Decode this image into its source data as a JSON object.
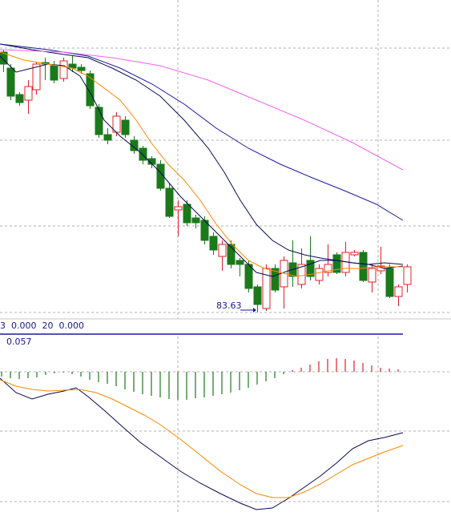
{
  "price_panel": {
    "low_marker_label": "83.63",
    "colors": {
      "up_candle": "#e0202a",
      "down_candle": "#1a7a1a",
      "ma_short": "#0a0a50",
      "ma_mid": "#ff8800",
      "ma_long": "#1a1aa0",
      "ma_longest": "#ee66ee",
      "grid": "#b0b0b0"
    }
  },
  "volume_header": {
    "text": "3  0.000  20  0.000"
  },
  "macd_header": {
    "text": "0.057"
  },
  "chart_data": [
    {
      "type": "candlestick",
      "title": "",
      "annotations": [
        "83.63"
      ],
      "moving_averages": [
        {
          "name": "",
          "color": "#0a0a50"
        },
        {
          "name": "",
          "color": "#ff8800"
        },
        {
          "name": "",
          "color": "#1a1aa0"
        },
        {
          "name": "",
          "color": "#ee66ee"
        }
      ]
    },
    {
      "type": "bar",
      "title": "",
      "values": [
        -0.6,
        -0.8,
        -0.9,
        -0.8,
        -0.7,
        -0.4,
        -0.2,
        -0.1,
        -0.3,
        -0.6,
        -1.0,
        -1.3,
        -1.5,
        -1.8,
        -2.2,
        -2.5,
        -2.8,
        -3.0,
        -3.2,
        -3.4,
        -3.5,
        -3.5,
        -3.3,
        -3.2,
        -3.0,
        -2.8,
        -2.6,
        -2.3,
        -2.0,
        -1.6,
        -1.2,
        -0.8,
        -0.3,
        0.2,
        0.5,
        0.9,
        1.3,
        1.6,
        1.7,
        1.6,
        1.4,
        1.1,
        0.8,
        0.5,
        0.4,
        0.3
      ],
      "colors": {
        "positive": "#e0202a",
        "negative": "#1a7a1a"
      },
      "lines": [
        {
          "name": "",
          "color": "#0a0a50"
        },
        {
          "name": "",
          "color": "#ff8800"
        }
      ]
    }
  ]
}
